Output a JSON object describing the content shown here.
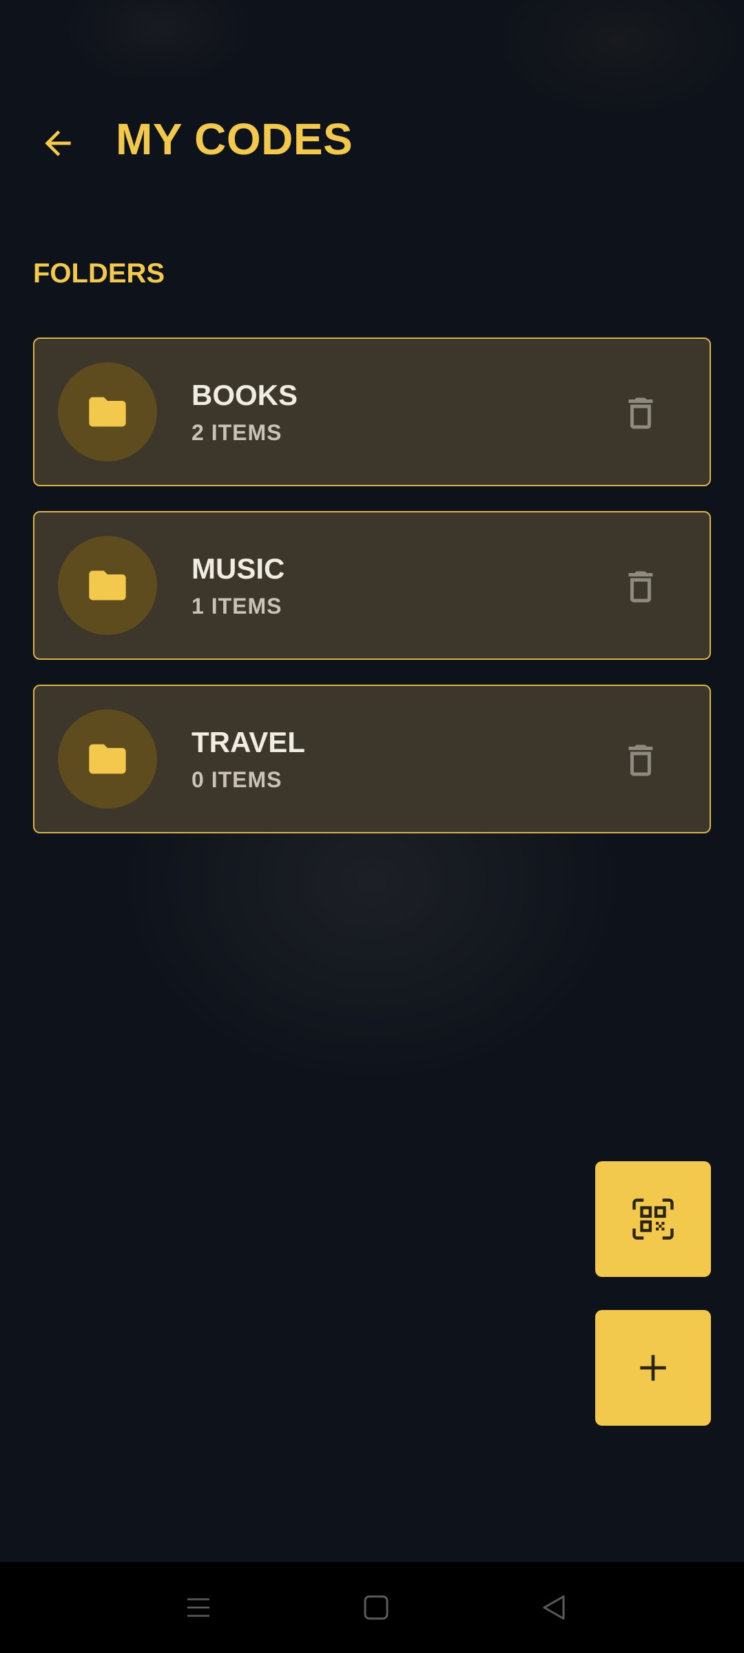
{
  "header": {
    "title": "MY CODES",
    "back_icon": "arrow-left-icon"
  },
  "section": {
    "title": "FOLDERS"
  },
  "folders": [
    {
      "name": "BOOKS",
      "count": "2 ITEMS",
      "icon": "folder-icon",
      "action_icon": "trash-icon"
    },
    {
      "name": "MUSIC",
      "count": "1 ITEMS",
      "icon": "folder-icon",
      "action_icon": "trash-icon"
    },
    {
      "name": "TRAVEL",
      "count": "0 ITEMS",
      "icon": "folder-icon",
      "action_icon": "trash-icon"
    }
  ],
  "fabs": {
    "scan_icon": "qr-scan-icon",
    "add_icon": "plus-icon"
  },
  "nav_bar": {
    "recents_icon": "menu-lines-icon",
    "home_icon": "square-home-icon",
    "back_icon": "triangle-back-icon"
  },
  "colors": {
    "accent": "#f2c94c",
    "background": "#0e121a",
    "card_background": "#3c362b",
    "card_border": "#d9b44a",
    "folder_avatar": "#5e4c1f",
    "text_primary": "#f1ece2",
    "text_secondary": "#c9c2b5",
    "icon_muted": "#8f8a80"
  }
}
